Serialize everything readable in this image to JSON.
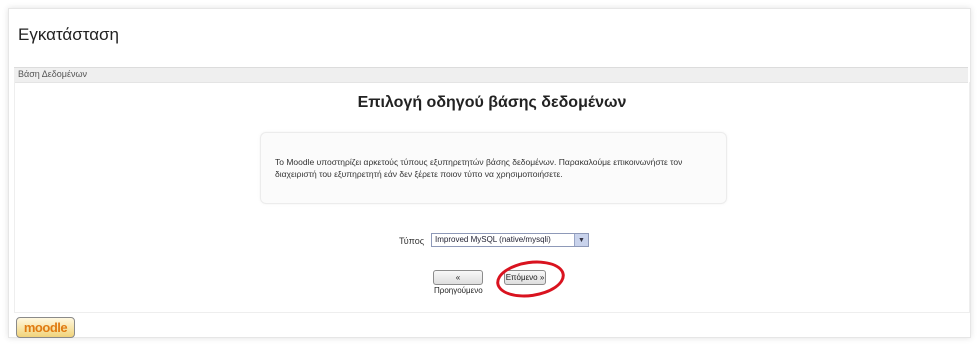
{
  "header": {
    "title": "Εγκατάσταση"
  },
  "breadcrumb": {
    "label": "Βάση Δεδομένων"
  },
  "main": {
    "heading": "Επιλογή οδηγού βάσης δεδομένων",
    "info_text": "Το Moodle υποστηρίζει αρκετούς τύπους εξυπηρετητών βάσης δεδομένων. Παρακαλούμε επικοινωνήστε τον διαχειριστή του εξυπηρετητή εάν δεν ξέρετε ποιον τύπο να χρησιμοποιήσετε.",
    "type_label": "Τύπος",
    "type_select_value": "Improved MySQL (native/mysqli)",
    "prev_button": "« Προηγούμενο",
    "next_button": "Επόμενο »"
  },
  "footer": {
    "logo_text": "moodle"
  },
  "colors": {
    "highlight": "#d9131f",
    "logo_text": "#e07b12"
  },
  "icons": {
    "select_arrow": "chevron-down-icon"
  }
}
